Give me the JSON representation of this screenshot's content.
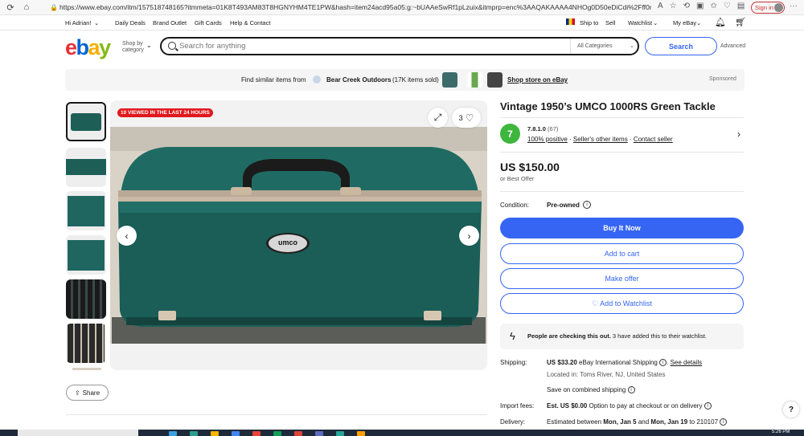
{
  "browser": {
    "url": "https://www.ebay.com/itm/157518748165?itmmeta=01K8T493AM83T8HGNYHM4TE1PW&hash=item24acd95a05:g:~bUAAeSwRf1pLzuix&itmprp=enc%3AAQAKAAAA4NHOg0D50eDiCdi%2Fff0r02s8yTbTUViHnzuSNHNRKX...",
    "signin_label": "Sign in"
  },
  "topnav": {
    "greeting": "Hi Adrian!",
    "daily_deals": "Daily Deals",
    "brand_outlet": "Brand Outlet",
    "gift_cards": "Gift Cards",
    "help_contact": "Help & Contact",
    "ship_to": "Ship to",
    "sell": "Sell",
    "watchlist": "Watchlist",
    "my_ebay": "My eBay"
  },
  "header": {
    "shop_by_line1": "Shop by",
    "shop_by_line2": "category",
    "search_placeholder": "Search for anything",
    "category_select": "All Categories",
    "search_button": "Search",
    "advanced": "Advanced"
  },
  "banner": {
    "find_similar": "Find similar items from",
    "store_name": "Bear Creek Outdoors",
    "store_stats": "(17K items sold)",
    "shop_store": "Shop store on eBay",
    "sponsored": "Sponsored"
  },
  "gallery": {
    "viewed_badge": "10 VIEWED IN THE LAST 24 HOURS",
    "watch_count": "3",
    "share_label": "Share",
    "badge_text": "umco"
  },
  "item": {
    "title": "Vintage 1950’s UMCO 1000RS Green Tackle",
    "seller_feedback_num": "7",
    "seller_score_prefix": "7.8.1.0",
    "seller_score_count": "(67)",
    "positive": "100% positive",
    "other_items": "Seller's other items",
    "contact": "Contact seller",
    "price": "US $150.00",
    "best_offer": "or Best Offer",
    "condition_label": "Condition:",
    "condition_value": "Pre-owned",
    "buy_now": "Buy It Now",
    "add_to_cart": "Add to cart",
    "make_offer": "Make offer",
    "add_watchlist": "♡ Add to Watchlist",
    "checking_bold": "People are checking this out.",
    "checking_rest": " 3 have added this to their watchlist.",
    "shipping_label": "Shipping:",
    "shipping_value": "US $33.20",
    "shipping_method": " eBay International Shipping ",
    "see_details": "See details",
    "located": "Located in: Toms River, NJ, United States",
    "save_combined": "Save on combined shipping",
    "import_label": "Import fees:",
    "import_value": "Est. US $0.00",
    "import_rest": " Option to pay at checkout or on delivery",
    "delivery_label": "Delivery:",
    "delivery_prefix": "Estimated between ",
    "delivery_date1": "Mon, Jan 5",
    "delivery_mid": " and ",
    "delivery_date2": "Mon, Jan 19",
    "delivery_suffix": " to 210107"
  },
  "taskbar": {
    "clock": "5:26 PM"
  },
  "colors": {
    "ebay_red": "#e53238",
    "ebay_blue": "#0064d2",
    "ebay_yellow": "#f5af02",
    "ebay_green": "#86b817",
    "primary_button": "#3665f3",
    "feedback_green": "#3db63d",
    "box_teal": "#1d5f57"
  }
}
